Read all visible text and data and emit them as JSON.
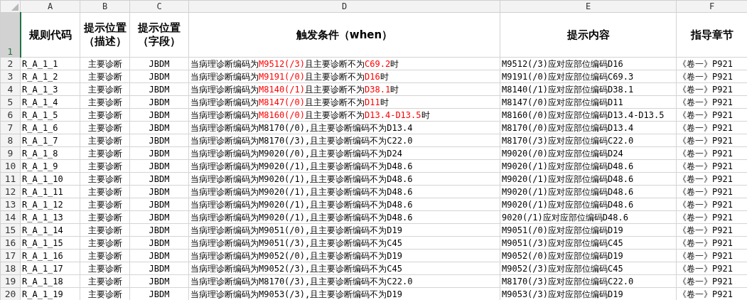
{
  "column_letters": [
    "A",
    "B",
    "C",
    "D",
    "E",
    "F"
  ],
  "header_row": {
    "number": "1",
    "selected": true,
    "cells": [
      "规则代码",
      "提示位置（描述）",
      "提示位置（字段）",
      "触发条件（when）",
      "提示内容",
      "指导章节"
    ]
  },
  "rows": [
    {
      "number": "2",
      "selected": false,
      "code": "R_A_1_1",
      "position": "主要诊断",
      "field": "JBDM",
      "condition": [
        {
          "text": "当病理诊断编码为",
          "highlight": false
        },
        {
          "text": "M9512(/3)",
          "highlight": true
        },
        {
          "text": "且主要诊断不为",
          "highlight": false
        },
        {
          "text": "C69.2",
          "highlight": true
        },
        {
          "text": "时",
          "highlight": false
        }
      ],
      "message": "M9512(/3)应对应部位编码D16",
      "chapter": "《卷一》P921"
    },
    {
      "number": "3",
      "selected": false,
      "code": "R_A_1_2",
      "position": "主要诊断",
      "field": "JBDM",
      "condition": [
        {
          "text": "当病理诊断编码为",
          "highlight": false
        },
        {
          "text": "M9191(/0)",
          "highlight": true
        },
        {
          "text": "且主要诊断不为",
          "highlight": false
        },
        {
          "text": "D16",
          "highlight": true
        },
        {
          "text": "时",
          "highlight": false
        }
      ],
      "message": "M9191(/0)应对应部位编码C69.3",
      "chapter": "《卷一》P921"
    },
    {
      "number": "4",
      "selected": false,
      "code": "R_A_1_3",
      "position": "主要诊断",
      "field": "JBDM",
      "condition": [
        {
          "text": "当病理诊断编码为",
          "highlight": false
        },
        {
          "text": "M8140(/1)",
          "highlight": true
        },
        {
          "text": "且主要诊断不为",
          "highlight": false
        },
        {
          "text": "D38.1",
          "highlight": true
        },
        {
          "text": "时",
          "highlight": false
        }
      ],
      "message": "M8140(/1)应对应部位编码D38.1",
      "chapter": "《卷一》P921"
    },
    {
      "number": "5",
      "selected": false,
      "code": "R_A_1_4",
      "position": "主要诊断",
      "field": "JBDM",
      "condition": [
        {
          "text": "当病理诊断编码为",
          "highlight": false
        },
        {
          "text": "M8147(/0)",
          "highlight": true
        },
        {
          "text": "且主要诊断不为",
          "highlight": false
        },
        {
          "text": "D11",
          "highlight": true
        },
        {
          "text": "时",
          "highlight": false
        }
      ],
      "message": "M8147(/0)应对应部位编码D11",
      "chapter": "《卷一》P921"
    },
    {
      "number": "6",
      "selected": false,
      "code": "R_A_1_5",
      "position": "主要诊断",
      "field": "JBDM",
      "condition": [
        {
          "text": "当病理诊断编码为",
          "highlight": false
        },
        {
          "text": "M8160(/0)",
          "highlight": true
        },
        {
          "text": "且主要诊断不为",
          "highlight": false
        },
        {
          "text": "D13.4-D13.5",
          "highlight": true
        },
        {
          "text": "时",
          "highlight": false
        }
      ],
      "message": "M8160(/0)应对应部位编码D13.4-D13.5",
      "chapter": "《卷一》P921"
    },
    {
      "number": "7",
      "selected": false,
      "code": "R_A_1_6",
      "position": "主要诊断",
      "field": "JBDM",
      "condition": [
        {
          "text": "当病理诊断编码为M8170(/0),且主要诊断编码不为D13.4",
          "highlight": false
        }
      ],
      "message": "M8170(/0)应对应部位编码D13.4",
      "chapter": "《卷一》P921"
    },
    {
      "number": "8",
      "selected": false,
      "code": "R_A_1_7",
      "position": "主要诊断",
      "field": "JBDM",
      "condition": [
        {
          "text": "当病理诊断编码为M8170(/3),且主要诊断编码不为C22.0",
          "highlight": false
        }
      ],
      "message": "M8170(/3)应对应部位编码C22.0",
      "chapter": "《卷一》P921"
    },
    {
      "number": "9",
      "selected": false,
      "code": "R_A_1_8",
      "position": "主要诊断",
      "field": "JBDM",
      "condition": [
        {
          "text": "当病理诊断编码为M9020(/0),且主要诊断编码不为D24",
          "highlight": false
        }
      ],
      "message": "M9020(/0)应对应部位编码D24",
      "chapter": "《卷一》P921"
    },
    {
      "number": "10",
      "selected": false,
      "code": "R_A_1_9",
      "position": "主要诊断",
      "field": "JBDM",
      "condition": [
        {
          "text": "当病理诊断编码为M9020(/1),且主要诊断编码不为D48.6",
          "highlight": false
        }
      ],
      "message": "M9020(/1)应对应部位编码D48.6",
      "chapter": "《卷一》P921"
    },
    {
      "number": "11",
      "selected": false,
      "code": "R_A_1_10",
      "position": "主要诊断",
      "field": "JBDM",
      "condition": [
        {
          "text": "当病理诊断编码为M9020(/1),且主要诊断编码不为D48.6",
          "highlight": false
        }
      ],
      "message": "M9020(/1)应对应部位编码D48.6",
      "chapter": "《卷一》P921"
    },
    {
      "number": "12",
      "selected": false,
      "code": "R_A_1_11",
      "position": "主要诊断",
      "field": "JBDM",
      "condition": [
        {
          "text": "当病理诊断编码为M9020(/1),且主要诊断编码不为D48.6",
          "highlight": false
        }
      ],
      "message": "M9020(/1)应对应部位编码D48.6",
      "chapter": "《卷一》P921"
    },
    {
      "number": "13",
      "selected": false,
      "code": "R_A_1_12",
      "position": "主要诊断",
      "field": "JBDM",
      "condition": [
        {
          "text": "当病理诊断编码为M9020(/1),且主要诊断编码不为D48.6",
          "highlight": false
        }
      ],
      "message": "M9020(/1)应对应部位编码D48.6",
      "chapter": "《卷一》P921"
    },
    {
      "number": "14",
      "selected": false,
      "code": "R_A_1_13",
      "position": "主要诊断",
      "field": "JBDM",
      "condition": [
        {
          "text": "当病理诊断编码为M9020(/1),且主要诊断编码不为D48.6",
          "highlight": false
        }
      ],
      "message": "9020(/1)应对应部位编码D48.6",
      "chapter": "《卷一》P921"
    },
    {
      "number": "15",
      "selected": false,
      "code": "R_A_1_14",
      "position": "主要诊断",
      "field": "JBDM",
      "condition": [
        {
          "text": "当病理诊断编码为M9051(/0),且主要诊断编码不为D19",
          "highlight": false
        }
      ],
      "message": "M9051(/0)应对应部位编码D19",
      "chapter": "《卷一》P921"
    },
    {
      "number": "16",
      "selected": false,
      "code": "R_A_1_15",
      "position": "主要诊断",
      "field": "JBDM",
      "condition": [
        {
          "text": "当病理诊断编码为M9051(/3),且主要诊断编码不为C45",
          "highlight": false
        }
      ],
      "message": "M9051(/3)应对应部位编码C45",
      "chapter": "《卷一》P921"
    },
    {
      "number": "17",
      "selected": false,
      "code": "R_A_1_16",
      "position": "主要诊断",
      "field": "JBDM",
      "condition": [
        {
          "text": "当病理诊断编码为M9052(/0),且主要诊断编码不为D19",
          "highlight": false
        }
      ],
      "message": "M9052(/0)应对应部位编码D19",
      "chapter": "《卷一》P921"
    },
    {
      "number": "18",
      "selected": false,
      "code": "R_A_1_17",
      "position": "主要诊断",
      "field": "JBDM",
      "condition": [
        {
          "text": "当病理诊断编码为M9052(/3),且主要诊断编码不为C45",
          "highlight": false
        }
      ],
      "message": "M9052(/3)应对应部位编码C45",
      "chapter": "《卷一》P921"
    },
    {
      "number": "19",
      "selected": false,
      "code": "R_A_1_18",
      "position": "主要诊断",
      "field": "JBDM",
      "condition": [
        {
          "text": "当病理诊断编码为M8170(/3),且主要诊断编码不为C22.0",
          "highlight": false
        }
      ],
      "message": "M8170(/3)应对应部位编码C22.0",
      "chapter": "《卷一》P921"
    },
    {
      "number": "20",
      "selected": false,
      "code": "R_A_1_19",
      "position": "主要诊断",
      "field": "JBDM",
      "condition": [
        {
          "text": "当病理诊断编码为M9053(/3),且主要诊断编码不为D19",
          "highlight": false
        }
      ],
      "message": "M9053(/3)应对应部位编码D19",
      "chapter": "《卷一》P921"
    }
  ]
}
